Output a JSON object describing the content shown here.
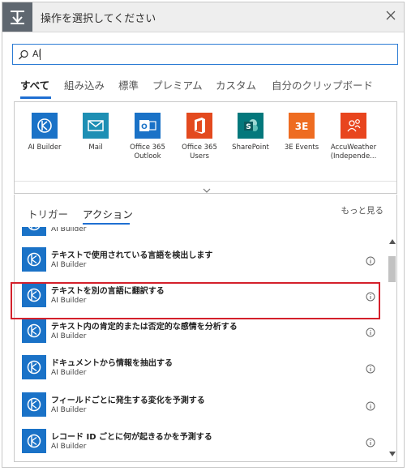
{
  "header": {
    "title": "操作を選択してください",
    "icon": "step-icon",
    "close_icon": "close-icon"
  },
  "search": {
    "value": "AI",
    "icon": "search-icon"
  },
  "tabs": [
    {
      "label": "すべて",
      "active": true
    },
    {
      "label": "組み込み"
    },
    {
      "label": "標準"
    },
    {
      "label": "プレミアム"
    },
    {
      "label": "カスタム"
    },
    {
      "label": "自分のクリップボード"
    }
  ],
  "connectors": [
    {
      "label": "AI Builder",
      "color": "#1a72c7",
      "icon": "ai-builder-icon"
    },
    {
      "label": "Mail",
      "color": "#1e8fb4",
      "icon": "mail-icon"
    },
    {
      "label": "Office 365 Outlook",
      "color": "#1a72c7",
      "icon": "outlook-icon"
    },
    {
      "label": "Office 365 Users",
      "color": "#e34a1f",
      "icon": "office-icon"
    },
    {
      "label": "SharePoint",
      "color": "#03787c",
      "icon": "sharepoint-icon"
    },
    {
      "label": "3E Events",
      "color": "#ee6c21",
      "icon": "3e-events-icon",
      "tile_text": "3E"
    },
    {
      "label": "AccuWeather (Independe...",
      "color": "#e8451e",
      "icon": "accuweather-icon"
    }
  ],
  "subtabs": [
    {
      "label": "トリガー"
    },
    {
      "label": "アクション",
      "active": true
    }
  ],
  "see_more": "もっと見る",
  "actions": [
    {
      "title": "",
      "subtitle": "AI Builder"
    },
    {
      "title": "テキストで使用されている言語を検出します",
      "subtitle": "AI Builder"
    },
    {
      "title": "テキストを別の言語に翻訳する",
      "subtitle": "AI Builder",
      "selected": true
    },
    {
      "title": "テキスト内の肯定的または否定的な感情を分析する",
      "subtitle": "AI Builder"
    },
    {
      "title": "ドキュメントから情報を抽出する",
      "subtitle": "AI Builder"
    },
    {
      "title": "フィールドごとに発生する変化を予測する",
      "subtitle": "AI Builder"
    },
    {
      "title": "レコード ID ごとに何が起きるかを予測する",
      "subtitle": "AI Builder"
    }
  ],
  "colors": {
    "accent": "#1f6fd2",
    "highlight": "#d4202b",
    "ai_builder": "#1a72c7"
  }
}
